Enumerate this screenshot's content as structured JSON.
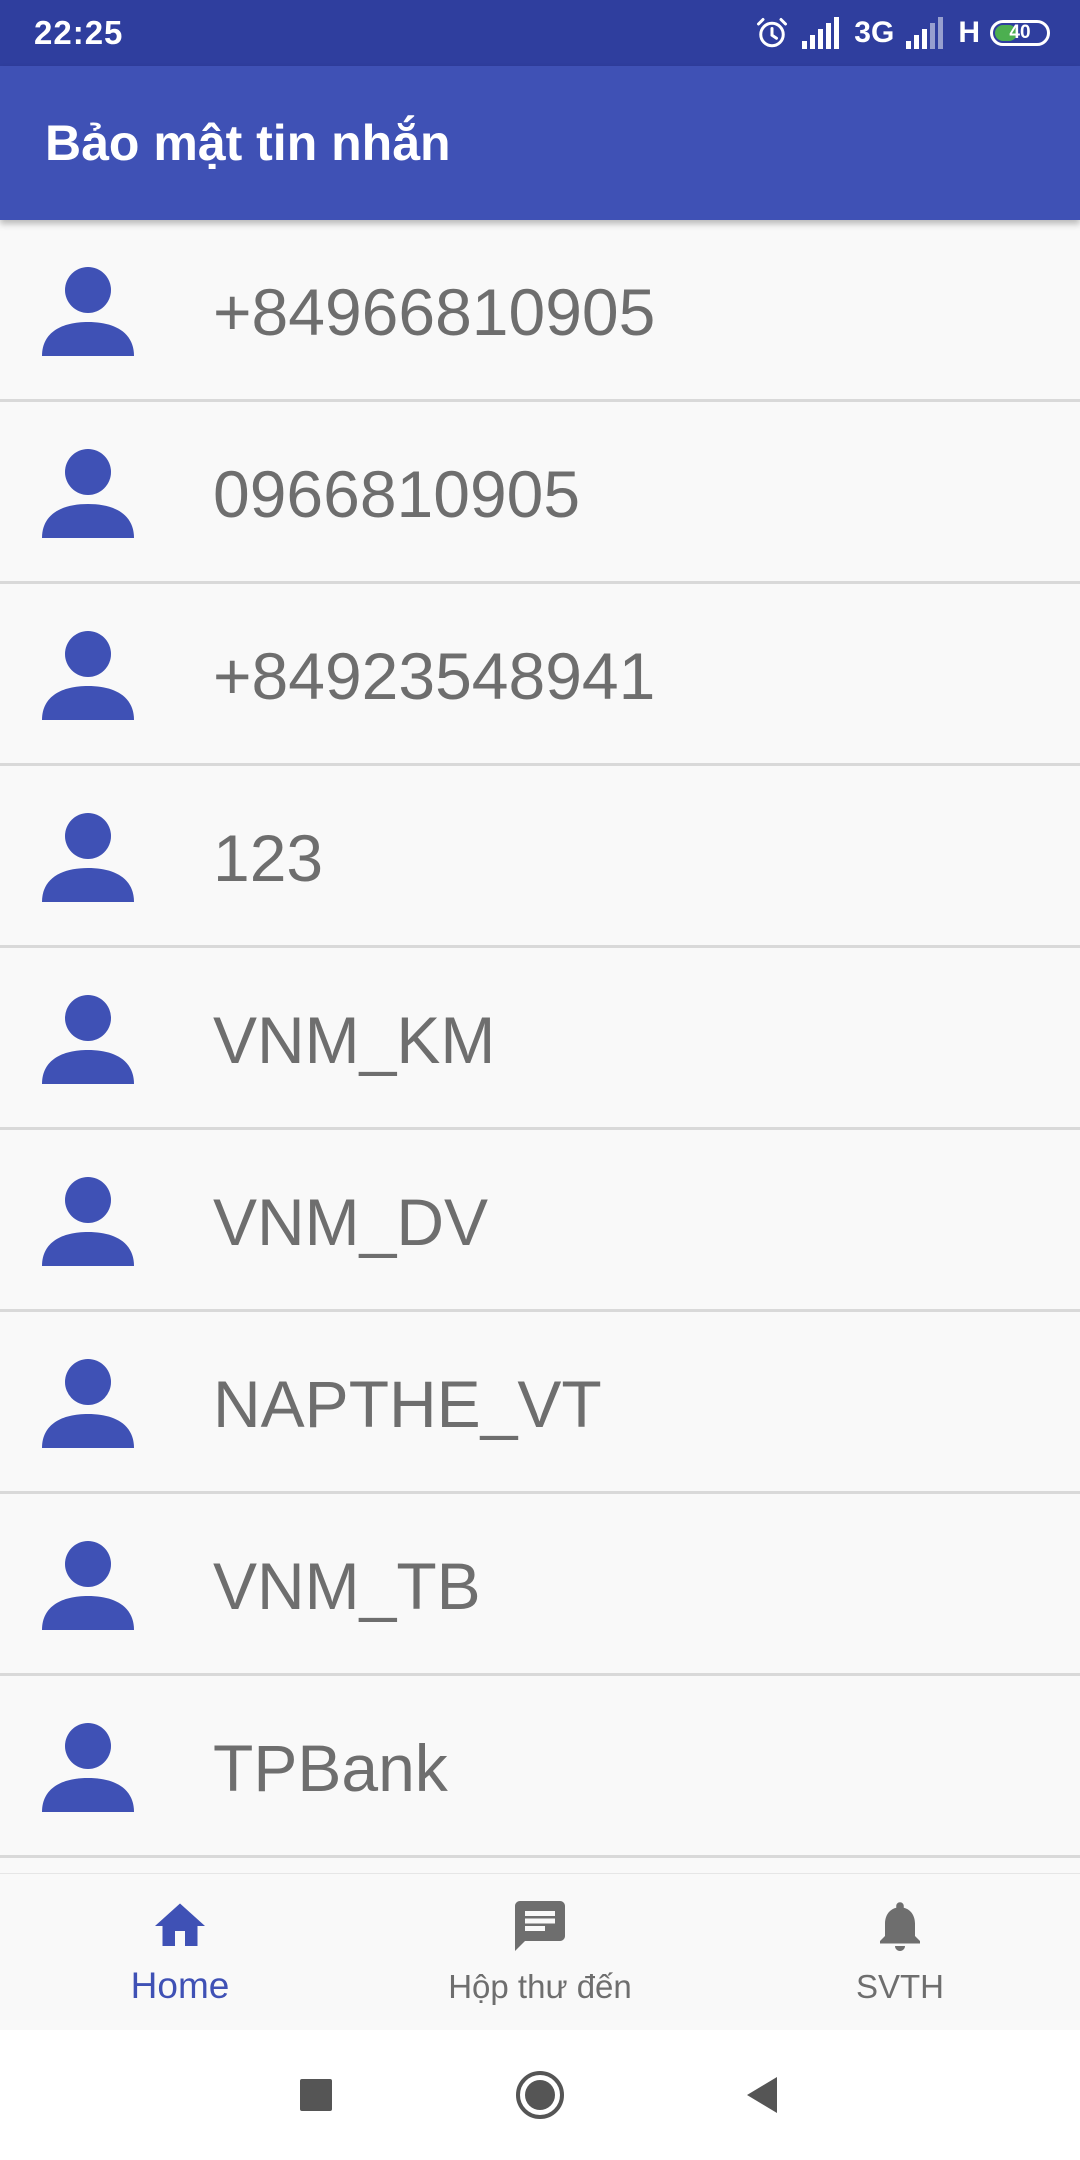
{
  "status_bar": {
    "time": "22:25",
    "network_1": "3G",
    "network_2": "H",
    "battery_level": "40",
    "battery_fraction": 0.4
  },
  "app_bar": {
    "title": "Bảo mật tin nhắn"
  },
  "contacts": [
    {
      "name": "+84966810905"
    },
    {
      "name": "0966810905"
    },
    {
      "name": "+84923548941"
    },
    {
      "name": "123"
    },
    {
      "name": "VNM_KM"
    },
    {
      "name": "VNM_DV"
    },
    {
      "name": "NAPTHE_VT"
    },
    {
      "name": "VNM_TB"
    },
    {
      "name": "TPBank"
    }
  ],
  "bottom_nav": {
    "active_index": 0,
    "items": [
      {
        "label": "Home",
        "icon": "home-icon"
      },
      {
        "label": "Hộp thư đến",
        "icon": "message-icon"
      },
      {
        "label": "SVTH",
        "icon": "bell-icon"
      }
    ]
  },
  "colors": {
    "primary": "#3f51b5",
    "primary_dark": "#2f3e9e",
    "text_secondary": "#6e6e6e",
    "background": "#f9f9f9"
  },
  "system_nav": {
    "buttons": [
      "recents-button",
      "home-button",
      "back-button"
    ]
  }
}
